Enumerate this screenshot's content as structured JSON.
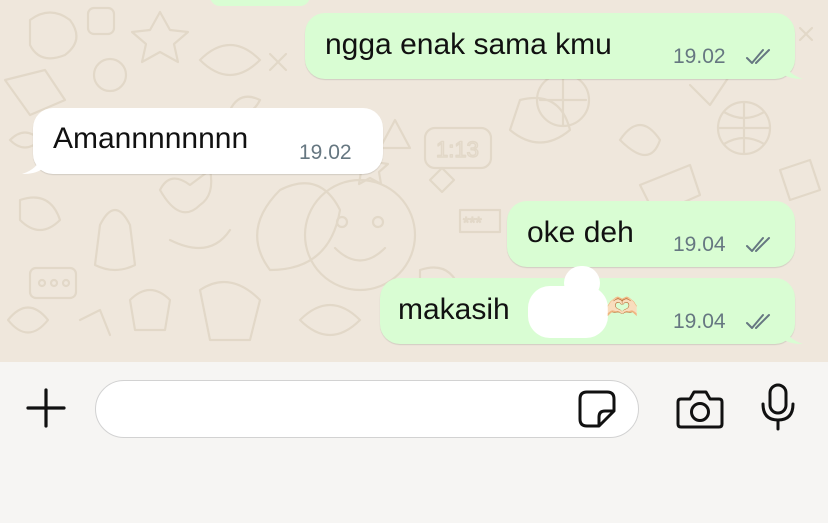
{
  "messages": [
    {
      "direction": "outgoing",
      "text": "ngga enak sama kmu",
      "time": "19.02",
      "status": "read-double-check"
    },
    {
      "direction": "incoming",
      "text": "Amannnnnnnn",
      "time": "19.02"
    },
    {
      "direction": "outgoing",
      "text": "oke deh",
      "time": "19.04",
      "status": "read-double-check"
    },
    {
      "direction": "outgoing",
      "text": "makasih",
      "emoji": "🫶🏻",
      "time": "19.04",
      "status": "read-double-check",
      "redacted": true
    }
  ],
  "composer": {
    "value": "",
    "placeholder": ""
  },
  "icons": {
    "attach": "plus-icon",
    "sticker": "sticker-icon",
    "camera": "camera-icon",
    "mic": "microphone-icon",
    "ticks": "double-check-icon"
  },
  "colors": {
    "outgoing_bubble": "#d9fdd3",
    "incoming_bubble": "#ffffff",
    "wallpaper": "#efe7dc",
    "timestamp": "#667781"
  }
}
